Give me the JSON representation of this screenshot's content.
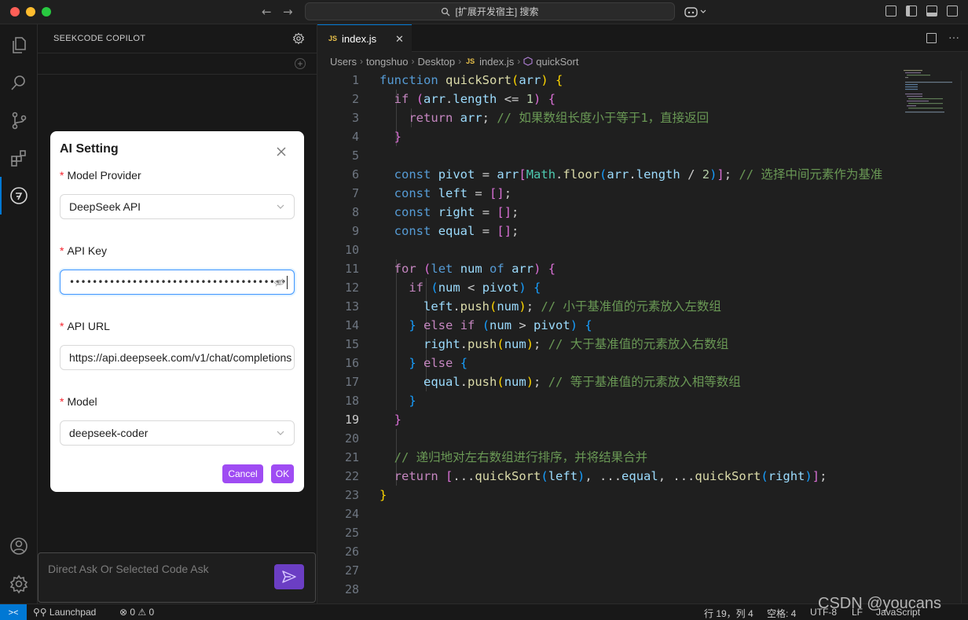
{
  "titlebar": {
    "search_text": "[扩展开发宿主] 搜索",
    "traffic_colors": [
      "#ff5f57",
      "#febc2e",
      "#28c840"
    ]
  },
  "activity": [
    "explorer-icon",
    "search-icon",
    "source-control-icon",
    "extensions-icon",
    "seekcode-icon"
  ],
  "activity_bottom": [
    "account-icon",
    "settings-gear-icon"
  ],
  "sidepanel": {
    "title": "SEEKCODE COPILOT",
    "chat_placeholder": "Direct Ask Or Selected Code Ask"
  },
  "modal": {
    "title": "AI Setting",
    "fields": {
      "provider": {
        "label": "Model Provider",
        "value": "DeepSeek API"
      },
      "api_key": {
        "label": "API Key",
        "value": "••••••••••••••••••••••••••••••••••••••"
      },
      "api_url": {
        "label": "API URL",
        "value": "https://api.deepseek.com/v1/chat/completions"
      },
      "model": {
        "label": "Model",
        "value": "deepseek-coder"
      }
    },
    "cancel_label": "Cancel",
    "ok_label": "OK",
    "required_mark": "*"
  },
  "editor": {
    "tab_badge": "JS",
    "tab_label": "index.js",
    "tab_close": "✕",
    "breadcrumb": [
      "Users",
      "tongshuo",
      "Desktop",
      "index.js",
      "quickSort"
    ],
    "current_line": 19,
    "line_numbers": [
      "1",
      "2",
      "3",
      "4",
      "5",
      "6",
      "7",
      "8",
      "9",
      "10",
      "11",
      "12",
      "13",
      "14",
      "15",
      "16",
      "17",
      "18",
      "19",
      "20",
      "21",
      "22",
      "23",
      "24",
      "25",
      "26",
      "27",
      "28"
    ]
  },
  "statusbar": {
    "launchpad": "Launchpad",
    "problems": "⊗ 0 ⚠ 0",
    "position": "行 19，列 4",
    "spaces": "空格: 4",
    "encoding": "UTF-8",
    "eol": "LF",
    "language": "JavaScript"
  },
  "watermark": "CSDN @youcans",
  "colors": {
    "accent": "#0078d4",
    "button_purple": "#9f4cf3",
    "send_purple": "#6b3ec4"
  }
}
